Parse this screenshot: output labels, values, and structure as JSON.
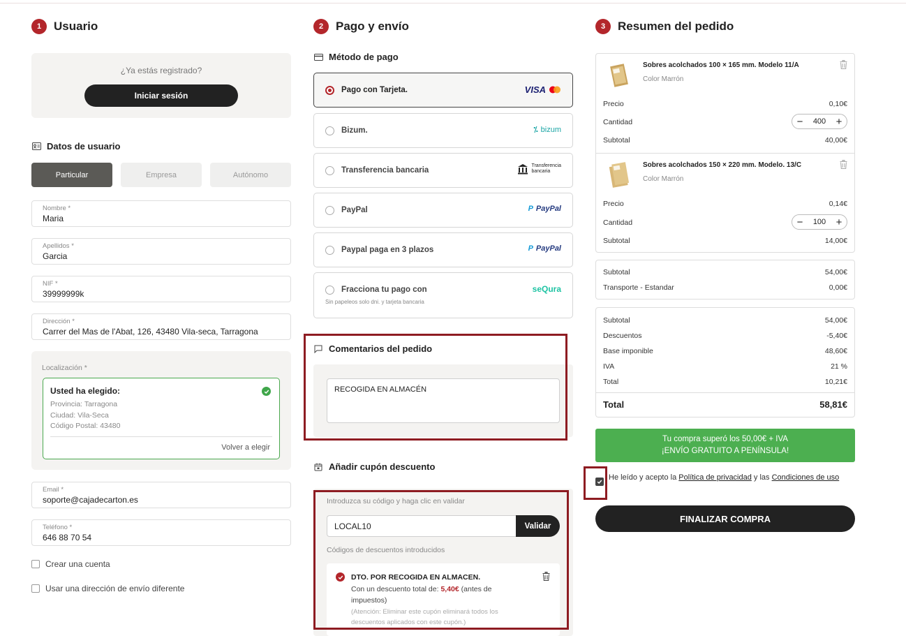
{
  "steps": [
    {
      "num": "1",
      "title": "Usuario"
    },
    {
      "num": "2",
      "title": "Pago y envío"
    },
    {
      "num": "3",
      "title": "Resumen del pedido"
    }
  ],
  "login": {
    "question": "¿Ya estás registrado?",
    "button": "Iniciar sesión"
  },
  "user_data": {
    "heading": "Datos de usuario",
    "types": [
      "Particular",
      "Empresa",
      "Autónomo"
    ],
    "active_type": "Particular",
    "fields": {
      "nombre": {
        "label": "Nombre *",
        "value": "Maria"
      },
      "apellidos": {
        "label": "Apellidos *",
        "value": "Garcia"
      },
      "nif": {
        "label": "NIF *",
        "value": "39999999k"
      },
      "direccion": {
        "label": "Dirección *",
        "value": "Carrer del Mas de l'Abat, 126, 43480 Vila-seca, Tarragona"
      },
      "email": {
        "label": "Email *",
        "value": "soporte@cajadecarton.es"
      },
      "telefono": {
        "label": "Teléfono *",
        "value": "646 88 70 54"
      }
    },
    "location": {
      "label": "Localización *",
      "title": "Usted ha elegido:",
      "provincia": "Provincia: Tarragona",
      "ciudad": "Ciudad: Vila-Seca",
      "cp": "Código Postal: 43480",
      "again": "Volver a elegir"
    },
    "create_account": "Crear una cuenta",
    "other_address": "Usar una dirección de envío diferente"
  },
  "payment": {
    "heading": "Método de pago",
    "options": [
      {
        "label": "Pago con Tarjeta.",
        "logo": "VISA",
        "selected": true
      },
      {
        "label": "Bizum.",
        "logo": "bizum"
      },
      {
        "label": "Transferencia bancaria",
        "logo_line1": "Transferencia",
        "logo_line2": "bancaria"
      },
      {
        "label": "PayPal",
        "logo": "PayPal"
      },
      {
        "label": "Paypal paga en 3 plazos",
        "logo": "PayPal"
      },
      {
        "label": "Fracciona tu pago con",
        "sub": "Sin papeleos solo dni. y tarjeta bancaria",
        "logo": "seQura"
      }
    ]
  },
  "comments": {
    "heading": "Comentarios del pedido",
    "value": "RECOGIDA EN ALMACÉN"
  },
  "coupon": {
    "heading": "Añadir cupón descuento",
    "help": "Introduzca su código y haga clic en validar",
    "value": "LOCAL10",
    "button": "Validar",
    "codes_heading": "Códigos de descuentos introducidos",
    "applied": {
      "title": "DTO. POR RECOGIDA EN ALMACEN.",
      "text_before": "Con un descuento total de:",
      "amount": "5,40€",
      "text_after": "(antes de impuestos)",
      "note": "(Atención: Eliminar este cupón eliminará todos los descuentos aplicados con este cupón.)"
    }
  },
  "summary": {
    "items": [
      {
        "name": "Sobres acolchados 100 × 165 mm. Modelo 11/A",
        "color": "Color Marrón",
        "precio_label": "Precio",
        "precio": "0,10€",
        "cantidad_label": "Cantidad",
        "cantidad": "400",
        "subtotal_label": "Subtotal",
        "subtotal": "40,00€"
      },
      {
        "name": "Sobres acolchados 150 × 220 mm. Modelo. 13/C",
        "color": "Color Marrón",
        "precio_label": "Precio",
        "precio": "0,14€",
        "cantidad_label": "Cantidad",
        "cantidad": "100",
        "subtotal_label": "Subtotal",
        "subtotal": "14,00€"
      }
    ],
    "shipping": {
      "subtotal_label": "Subtotal",
      "subtotal": "54,00€",
      "transport_label": "Transporte - Estandar",
      "transport": "0,00€"
    },
    "totals": {
      "subtotal_label": "Subtotal",
      "subtotal": "54,00€",
      "descuentos_label": "Descuentos",
      "descuentos": "-5,40€",
      "base_label": "Base imponible",
      "base": "48,60€",
      "iva_label": "IVA",
      "iva": "21 %",
      "total_label": "Total",
      "total": "10,21€",
      "grand_label": "Total",
      "grand": "58,81€"
    },
    "free_shipping_line1": "Tu compra superó los 50,00€ + IVA",
    "free_shipping_line2": "¡ENVÍO GRATUITO A PENÍNSULA!",
    "terms_before": "He leído y acepto la",
    "terms_privacy": "Política de privacidad",
    "terms_and": "y las",
    "terms_conditions": "Condiciones de uso",
    "finalize": "FINALIZAR COMPRA"
  },
  "colors": {
    "accent": "#b3262b",
    "dark": "#222222",
    "green": "#4caf50",
    "frame": "#8e1c22"
  }
}
